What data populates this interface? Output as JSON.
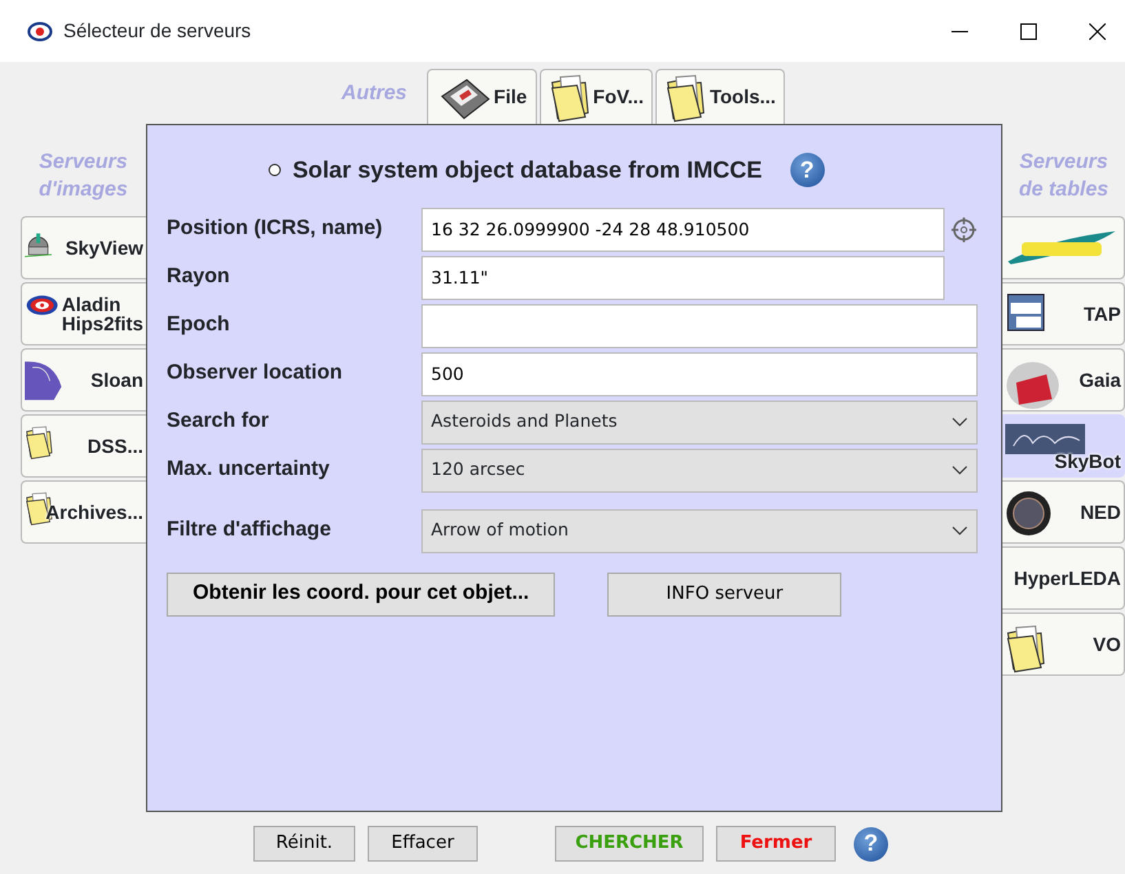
{
  "window": {
    "title": "Sélecteur de serveurs"
  },
  "top_tabs": {
    "label": "Autres",
    "items": [
      {
        "label": "File",
        "selected": false
      },
      {
        "label": "FoV...",
        "selected": false
      },
      {
        "label": "Tools...",
        "selected": false
      }
    ]
  },
  "image_servers": {
    "label": "Serveurs d'images",
    "items": [
      {
        "label": "SkyView",
        "selected": false
      },
      {
        "label": "Aladin\nHips2fits",
        "selected": false
      },
      {
        "label": "Sloan",
        "selected": false
      },
      {
        "label": "DSS...",
        "selected": false
      },
      {
        "label": "Archives...",
        "selected": false
      }
    ]
  },
  "table_servers": {
    "label": "Serveurs de tables",
    "items": [
      {
        "selected": false
      },
      {
        "label": "TAP",
        "selected": false
      },
      {
        "label": "Gaia",
        "selected": false
      },
      {
        "label": "SkyBot",
        "selected": true
      },
      {
        "label": "NED",
        "selected": false
      },
      {
        "label": "HyperLEDA",
        "selected": false
      },
      {
        "label": "VO",
        "selected": false
      }
    ]
  },
  "panel": {
    "title": "Solar system object database from IMCCE",
    "radio_checked": false,
    "help": "?",
    "fields": [
      {
        "kind": "position",
        "label": "Position (ICRS, name)",
        "value": "16 32 26.0999900 -24 28 48.910500"
      },
      {
        "kind": "short",
        "label": "Rayon",
        "value": "31.11\""
      },
      {
        "kind": "text",
        "label": "Epoch"
      },
      {
        "kind": "text",
        "label": "Observer location",
        "value": "500"
      },
      {
        "kind": "select",
        "label": "Search for",
        "value": "Asteroids and Planets"
      },
      {
        "kind": "select",
        "label": "Max. uncertainty",
        "value": "120 arcsec"
      }
    ],
    "display_filter": {
      "label": "Filtre d'affichage",
      "value": "Arrow of motion"
    },
    "buttons": [
      {
        "kind": "bold",
        "label": "Obtenir les coord. pour cet objet..."
      },
      {
        "kind": "plain",
        "label": "INFO serveur"
      }
    ]
  },
  "footer": {
    "buttons": [
      {
        "kind": "plain",
        "label": "Réinit."
      },
      {
        "kind": "plain",
        "label": "Effacer"
      },
      {
        "kind": "search",
        "label": "CHERCHER"
      },
      {
        "kind": "close",
        "label": "Fermer"
      }
    ],
    "help": "?"
  }
}
